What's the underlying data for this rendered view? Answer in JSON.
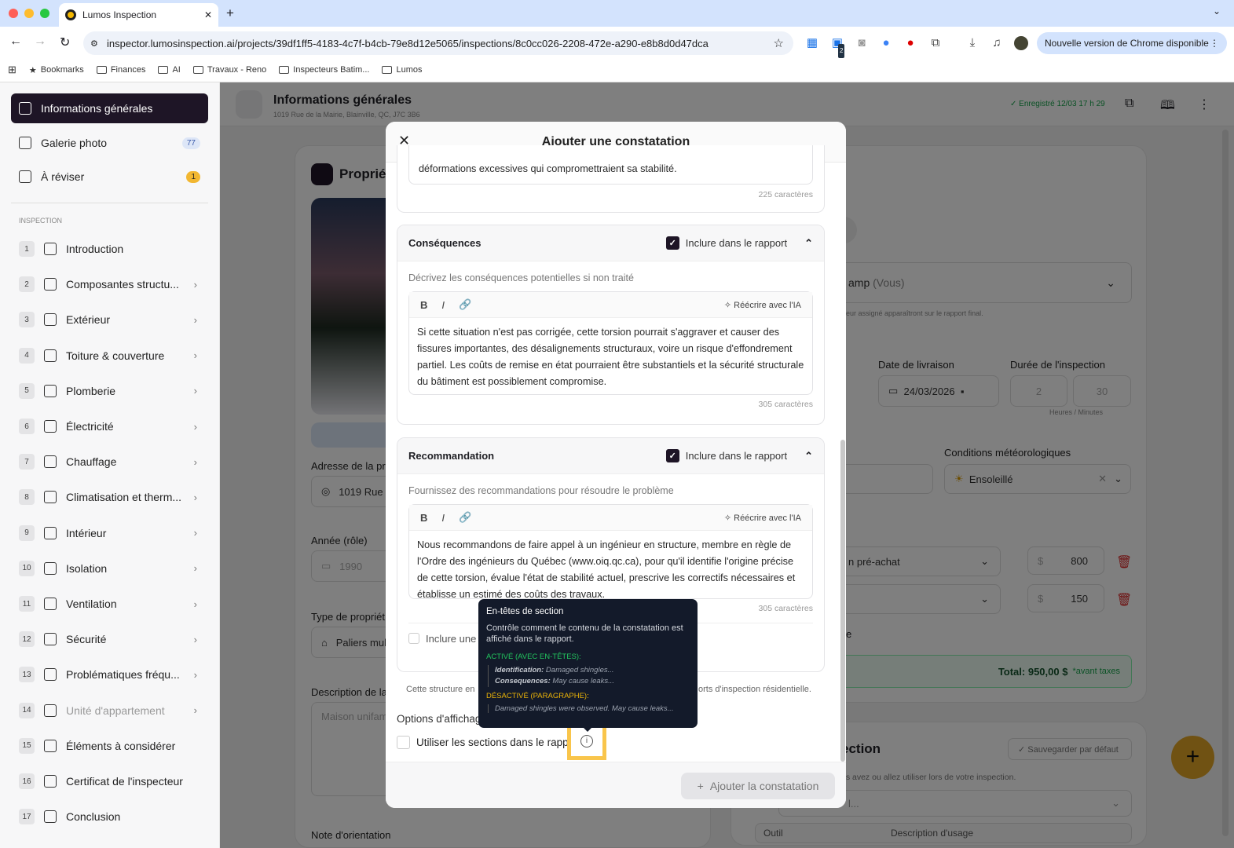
{
  "browser": {
    "tab_title": "Lumos Inspection",
    "url": "inspector.lumosinspection.ai/projects/39df1ff5-4183-4c7f-b4cb-79e8d12e5065/inspections/8c0cc026-2208-472e-a290-e8b8d0d47dca",
    "update_label": "Nouvelle version de Chrome disponible",
    "ext_badge": "2",
    "bookmarks": [
      "Bookmarks",
      "Finances",
      "AI",
      "Travaux - Reno",
      "Inspecteurs Batim...",
      "Lumos"
    ]
  },
  "sidebar": {
    "top": [
      {
        "label": "Informations générales"
      },
      {
        "label": "Galerie photo",
        "badge": "77"
      },
      {
        "label": "À réviser",
        "badge": "1"
      }
    ],
    "section": "INSPECTION",
    "items": [
      {
        "n": "1",
        "label": "Introduction"
      },
      {
        "n": "2",
        "label": "Composantes structu..."
      },
      {
        "n": "3",
        "label": "Extérieur"
      },
      {
        "n": "4",
        "label": "Toiture & couverture"
      },
      {
        "n": "5",
        "label": "Plomberie"
      },
      {
        "n": "6",
        "label": "Électricité"
      },
      {
        "n": "7",
        "label": "Chauffage"
      },
      {
        "n": "8",
        "label": "Climatisation et therm..."
      },
      {
        "n": "9",
        "label": "Intérieur"
      },
      {
        "n": "10",
        "label": "Isolation"
      },
      {
        "n": "11",
        "label": "Ventilation"
      },
      {
        "n": "12",
        "label": "Sécurité"
      },
      {
        "n": "13",
        "label": "Problématiques fréqu..."
      },
      {
        "n": "14",
        "label": "Unité d'appartement"
      },
      {
        "n": "15",
        "label": "Éléments à considérer"
      },
      {
        "n": "16",
        "label": "Certificat de l'inspecteur"
      },
      {
        "n": "17",
        "label": "Conclusion"
      }
    ]
  },
  "header": {
    "title": "Informations générales",
    "address": "1019 Rue de la Mairie, Blainville, QC, J7C 3B6",
    "saved": "Enregistré 12/03 17 h 29"
  },
  "background": {
    "property_title": "Propriét",
    "address_label": "Adresse de la pro",
    "address_value": "1019 Rue d",
    "year_label": "Année (rôle)",
    "year_value": "1990",
    "type_label": "Type de propriét",
    "type_value": "Paliers mult",
    "desc_label": "Description de la",
    "desc_placeholder": "Maison unifami",
    "note_label": "Note d'orientation",
    "inspector_value": "amp",
    "inspector_suffix": "(Vous)",
    "inspector_hint": "eur assigné apparaîtront sur le rapport final.",
    "delivery_label": "Date de livraison",
    "delivery_value": "24/03/2026",
    "duration_label": "Durée de l'inspection",
    "hours": "2",
    "minutes": "30",
    "duration_hint": "Heures / Minutes",
    "weather_label": "Conditions météorologiques",
    "weather_value": "Ensoleillé",
    "service1": "n pré-achat",
    "price1": "800",
    "price2": "150",
    "currency": "$",
    "frag_e": "e",
    "total": "Total: 950,00 $",
    "total_note": "*avant taxes",
    "tools_title": "ection",
    "tools_save": "Sauvegarder par défaut",
    "tools_hint": "us avez ou allez utiliser lors de votre inspection.",
    "tools_select": "l...",
    "tools_col1": "Outil",
    "tools_col2": "Description d'usage"
  },
  "modal": {
    "title": "Ajouter une constatation",
    "prev_text": "déformations excessives qui compromettraient sa stabilité.",
    "prev_count": "225 caractères",
    "sections": [
      {
        "title": "Conséquences",
        "include": "Inclure dans le rapport",
        "hint": "Décrivez les conséquences potentielles si non traité",
        "ai": "Réécrire avec l'IA",
        "text": "Si cette situation n'est pas corrigée, cette torsion pourrait s'aggraver et causer des fissures importantes, des désalignements structuraux, voire un risque d'effondrement partiel. Les coûts de remise en état pourraient être substantiels et la sécurité structurale du bâtiment est possiblement compromise.",
        "count": "305 caractères"
      },
      {
        "title": "Recommandation",
        "include": "Inclure dans le rapport",
        "hint": "Fournissez des recommandations pour résoudre le problème",
        "ai": "Réécrire avec l'IA",
        "text": "Nous recommandons de faire appel à un ingénieur en structure, membre en règle de l'Ordre des ingénieurs du Québec (www.oiq.qc.ca), pour qu'il identifie l'origine précise de cette torsion, évalue l'état de stabilité actuel, prescrive les correctifs nécessaires et établisse un estimé des coûts des travaux.",
        "count": "305 caractères",
        "extra_checkbox": "Inclure une p"
      }
    ],
    "structure_note_a": "Cette structure en",
    "structure_note_b": "orts d'inspection résidentielle.",
    "options_label": "Options d'affichag",
    "use_sections": "Utiliser les sections dans le rappo",
    "submit": "Ajouter la constatation"
  },
  "tooltip": {
    "title": "En-têtes de section",
    "desc": "Contrôle comment le contenu de la constatation est affiché dans le rapport.",
    "on_label": "ACTIVÉ (AVEC EN-TÊTES):",
    "on_l1_key": "Identification:",
    "on_l1_val": "Damaged shingles...",
    "on_l2_key": "Consequences:",
    "on_l2_val": "May cause leaks...",
    "off_label": "DÉSACTIVÉ (PARAGRAPHE):",
    "off_text": "Damaged shingles were observed. May cause leaks..."
  },
  "colors": {
    "accent": "#1e1526",
    "on": "#22c55e",
    "off": "#eab308",
    "highlight": "#f9c54b",
    "fab": "#e0a526"
  }
}
